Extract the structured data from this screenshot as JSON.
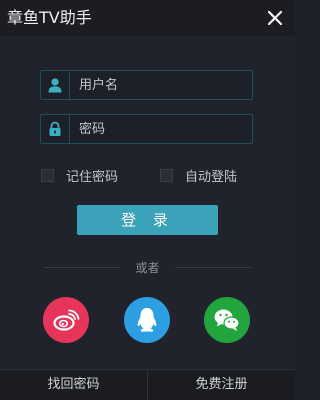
{
  "window": {
    "title": "章鱼TV助手"
  },
  "login_form": {
    "username_placeholder": "用户名",
    "password_placeholder": "密码",
    "remember_password_label": "记住密码",
    "auto_login_label": "自动登陆",
    "login_button_label": "登 录"
  },
  "divider": {
    "text": "或者"
  },
  "social": [
    {
      "name": "weibo",
      "icon": "weibo-icon",
      "color": "#e6345a"
    },
    {
      "name": "qq",
      "icon": "qq-icon",
      "color": "#2c9ee2"
    },
    {
      "name": "wechat",
      "icon": "wechat-icon",
      "color": "#22a53d"
    }
  ],
  "footer": {
    "recover_password_label": "找回密码",
    "register_label": "免费注册"
  },
  "colors": {
    "accent": "#3aa2b9",
    "field_border": "#1e4f57",
    "background": "#20232b"
  }
}
